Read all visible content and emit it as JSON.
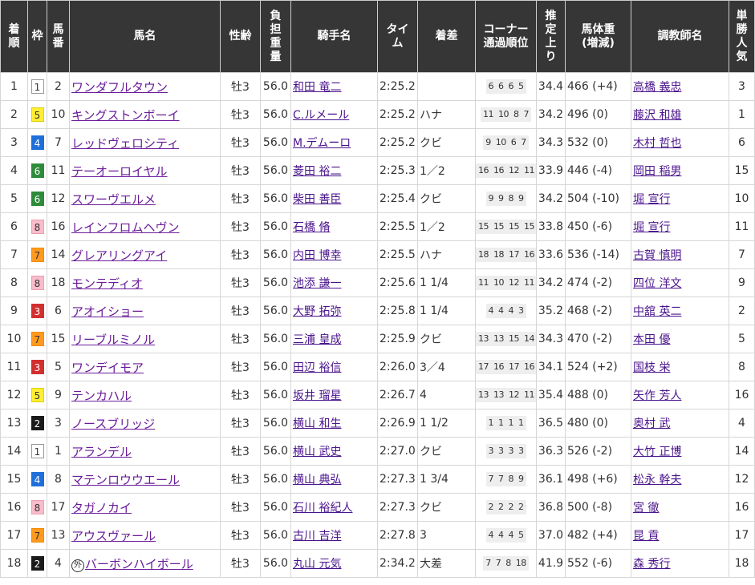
{
  "headers": [
    "着順",
    "枠",
    "馬番",
    "馬名",
    "性齢",
    "負担重量",
    "騎手名",
    "タイム",
    "着差",
    "コーナー通過順位",
    "推定上り",
    "馬体重(増減)",
    "調教師名",
    "単勝人気"
  ],
  "header_lines": {
    "rank": [
      "着",
      "順"
    ],
    "frame": [
      "枠"
    ],
    "num": [
      "馬",
      "番"
    ],
    "name": [
      "馬名"
    ],
    "sexage": [
      "性齢"
    ],
    "weight": [
      "負",
      "担",
      "重",
      "量"
    ],
    "jockey": [
      "騎手名"
    ],
    "time": [
      "タイ",
      "ム"
    ],
    "margin": [
      "着差"
    ],
    "corner": [
      "コーナー",
      "通過順位"
    ],
    "last3f": [
      "推",
      "定",
      "上",
      "り"
    ],
    "bodyweight": [
      "馬体重",
      "(増減)"
    ],
    "trainer": [
      "調教師名"
    ],
    "pop": [
      "単",
      "勝",
      "人",
      "気"
    ]
  },
  "foreign_mark": "外",
  "frame_colors": {
    "1": "#ffffff",
    "2": "#1a1a1a",
    "3": "#d32f2f",
    "4": "#1e6fd9",
    "5": "#ffee33",
    "6": "#2e8b3b",
    "7": "#ff9a1f",
    "8": "#f8bccb"
  },
  "rows": [
    {
      "rank": "1",
      "frame": "1",
      "num": "2",
      "name": "ワンダフルタウン",
      "foreign": false,
      "sexage": "牡3",
      "weight": "56.0",
      "jockey": "和田 竜二",
      "time": "2:25.2",
      "margin": "",
      "corner": [
        "6",
        "6",
        "6",
        "5"
      ],
      "last3f": "34.4",
      "bodyweight": "466 (+4)",
      "trainer": "高橋 義忠",
      "pop": "3"
    },
    {
      "rank": "2",
      "frame": "5",
      "num": "10",
      "name": "キングストンボーイ",
      "foreign": false,
      "sexage": "牡3",
      "weight": "56.0",
      "jockey": "C.ルメール",
      "time": "2:25.2",
      "margin": "ハナ",
      "corner": [
        "11",
        "10",
        "8",
        "7"
      ],
      "last3f": "34.2",
      "bodyweight": "496 (0)",
      "trainer": "藤沢 和雄",
      "pop": "1"
    },
    {
      "rank": "3",
      "frame": "4",
      "num": "7",
      "name": "レッドヴェロシティ",
      "foreign": false,
      "sexage": "牡3",
      "weight": "56.0",
      "jockey": "M.デムーロ",
      "time": "2:25.2",
      "margin": "クビ",
      "corner": [
        "9",
        "10",
        "6",
        "7"
      ],
      "last3f": "34.3",
      "bodyweight": "532 (0)",
      "trainer": "木村 哲也",
      "pop": "6"
    },
    {
      "rank": "4",
      "frame": "6",
      "num": "11",
      "name": "テーオーロイヤル",
      "foreign": false,
      "sexage": "牡3",
      "weight": "56.0",
      "jockey": "菱田 裕二",
      "time": "2:25.3",
      "margin": "1／2",
      "corner": [
        "16",
        "16",
        "12",
        "11"
      ],
      "last3f": "33.9",
      "bodyweight": "446 (-4)",
      "trainer": "岡田 稲男",
      "pop": "15"
    },
    {
      "rank": "5",
      "frame": "6",
      "num": "12",
      "name": "スワーヴエルメ",
      "foreign": false,
      "sexage": "牡3",
      "weight": "56.0",
      "jockey": "柴田 善臣",
      "time": "2:25.4",
      "margin": "クビ",
      "corner": [
        "9",
        "9",
        "8",
        "9"
      ],
      "last3f": "34.2",
      "bodyweight": "504 (-10)",
      "trainer": "堀 宣行",
      "pop": "10"
    },
    {
      "rank": "6",
      "frame": "8",
      "num": "16",
      "name": "レインフロムヘヴン",
      "foreign": false,
      "sexage": "牡3",
      "weight": "56.0",
      "jockey": "石橋 脩",
      "time": "2:25.5",
      "margin": "1／2",
      "corner": [
        "15",
        "15",
        "15",
        "15"
      ],
      "last3f": "33.8",
      "bodyweight": "450 (-6)",
      "trainer": "堀 宣行",
      "pop": "11"
    },
    {
      "rank": "7",
      "frame": "7",
      "num": "14",
      "name": "グレアリングアイ",
      "foreign": false,
      "sexage": "牡3",
      "weight": "56.0",
      "jockey": "内田 博幸",
      "time": "2:25.5",
      "margin": "ハナ",
      "corner": [
        "18",
        "18",
        "17",
        "16"
      ],
      "last3f": "33.6",
      "bodyweight": "536 (-14)",
      "trainer": "古賀 慎明",
      "pop": "7"
    },
    {
      "rank": "8",
      "frame": "8",
      "num": "18",
      "name": "モンテディオ",
      "foreign": false,
      "sexage": "牡3",
      "weight": "56.0",
      "jockey": "池添 謙一",
      "time": "2:25.6",
      "margin": "1 1/4",
      "corner": [
        "11",
        "10",
        "12",
        "11"
      ],
      "last3f": "34.2",
      "bodyweight": "474 (-2)",
      "trainer": "四位 洋文",
      "pop": "9"
    },
    {
      "rank": "9",
      "frame": "3",
      "num": "6",
      "name": "アオイショー",
      "foreign": false,
      "sexage": "牡3",
      "weight": "56.0",
      "jockey": "大野 拓弥",
      "time": "2:25.8",
      "margin": "1 1/4",
      "corner": [
        "4",
        "4",
        "4",
        "3"
      ],
      "last3f": "35.2",
      "bodyweight": "468 (-2)",
      "trainer": "中舘 英二",
      "pop": "2"
    },
    {
      "rank": "10",
      "frame": "7",
      "num": "15",
      "name": "リーブルミノル",
      "foreign": false,
      "sexage": "牡3",
      "weight": "56.0",
      "jockey": "三浦 皇成",
      "time": "2:25.9",
      "margin": "クビ",
      "corner": [
        "13",
        "13",
        "15",
        "14"
      ],
      "last3f": "34.3",
      "bodyweight": "470 (-2)",
      "trainer": "本田 優",
      "pop": "5"
    },
    {
      "rank": "11",
      "frame": "3",
      "num": "5",
      "name": "ワンデイモア",
      "foreign": false,
      "sexage": "牡3",
      "weight": "56.0",
      "jockey": "田辺 裕信",
      "time": "2:26.0",
      "margin": "3／4",
      "corner": [
        "17",
        "16",
        "17",
        "16"
      ],
      "last3f": "34.1",
      "bodyweight": "524 (+2)",
      "trainer": "国枝 栄",
      "pop": "8"
    },
    {
      "rank": "12",
      "frame": "5",
      "num": "9",
      "name": "テンカハル",
      "foreign": false,
      "sexage": "牡3",
      "weight": "56.0",
      "jockey": "坂井 瑠星",
      "time": "2:26.7",
      "margin": "4",
      "corner": [
        "13",
        "13",
        "12",
        "11"
      ],
      "last3f": "35.4",
      "bodyweight": "488 (0)",
      "trainer": "矢作 芳人",
      "pop": "16"
    },
    {
      "rank": "13",
      "frame": "2",
      "num": "3",
      "name": "ノースブリッジ",
      "foreign": false,
      "sexage": "牡3",
      "weight": "56.0",
      "jockey": "横山 和生",
      "time": "2:26.9",
      "margin": "1 1/2",
      "corner": [
        "1",
        "1",
        "1",
        "1"
      ],
      "last3f": "36.5",
      "bodyweight": "480 (0)",
      "trainer": "奥村 武",
      "pop": "4"
    },
    {
      "rank": "14",
      "frame": "1",
      "num": "1",
      "name": "アランデル",
      "foreign": false,
      "sexage": "牡3",
      "weight": "56.0",
      "jockey": "横山 武史",
      "time": "2:27.0",
      "margin": "クビ",
      "corner": [
        "3",
        "3",
        "3",
        "3"
      ],
      "last3f": "36.3",
      "bodyweight": "526 (-2)",
      "trainer": "大竹 正博",
      "pop": "14"
    },
    {
      "rank": "15",
      "frame": "4",
      "num": "8",
      "name": "マテンロウウエール",
      "foreign": false,
      "sexage": "牡3",
      "weight": "56.0",
      "jockey": "横山 典弘",
      "time": "2:27.3",
      "margin": "1 3/4",
      "corner": [
        "7",
        "7",
        "8",
        "9"
      ],
      "last3f": "36.1",
      "bodyweight": "498 (+6)",
      "trainer": "松永 幹夫",
      "pop": "12"
    },
    {
      "rank": "16",
      "frame": "8",
      "num": "17",
      "name": "タガノカイ",
      "foreign": false,
      "sexage": "牡3",
      "weight": "56.0",
      "jockey": "石川 裕紀人",
      "time": "2:27.3",
      "margin": "クビ",
      "corner": [
        "2",
        "2",
        "2",
        "2"
      ],
      "last3f": "36.8",
      "bodyweight": "500 (-8)",
      "trainer": "宮 徹",
      "pop": "16"
    },
    {
      "rank": "17",
      "frame": "7",
      "num": "13",
      "name": "アウスヴァール",
      "foreign": false,
      "sexage": "牡3",
      "weight": "56.0",
      "jockey": "古川 吉洋",
      "time": "2:27.8",
      "margin": "3",
      "corner": [
        "4",
        "4",
        "4",
        "5"
      ],
      "last3f": "37.0",
      "bodyweight": "482 (+4)",
      "trainer": "昆 貢",
      "pop": "17"
    },
    {
      "rank": "18",
      "frame": "2",
      "num": "4",
      "name": "バーボンハイボール",
      "foreign": true,
      "sexage": "牡3",
      "weight": "56.0",
      "jockey": "丸山 元気",
      "time": "2:34.2",
      "margin": "大差",
      "corner": [
        "7",
        "7",
        "8",
        "18"
      ],
      "last3f": "41.9",
      "bodyweight": "552 (-6)",
      "trainer": "森 秀行",
      "pop": "18"
    }
  ]
}
